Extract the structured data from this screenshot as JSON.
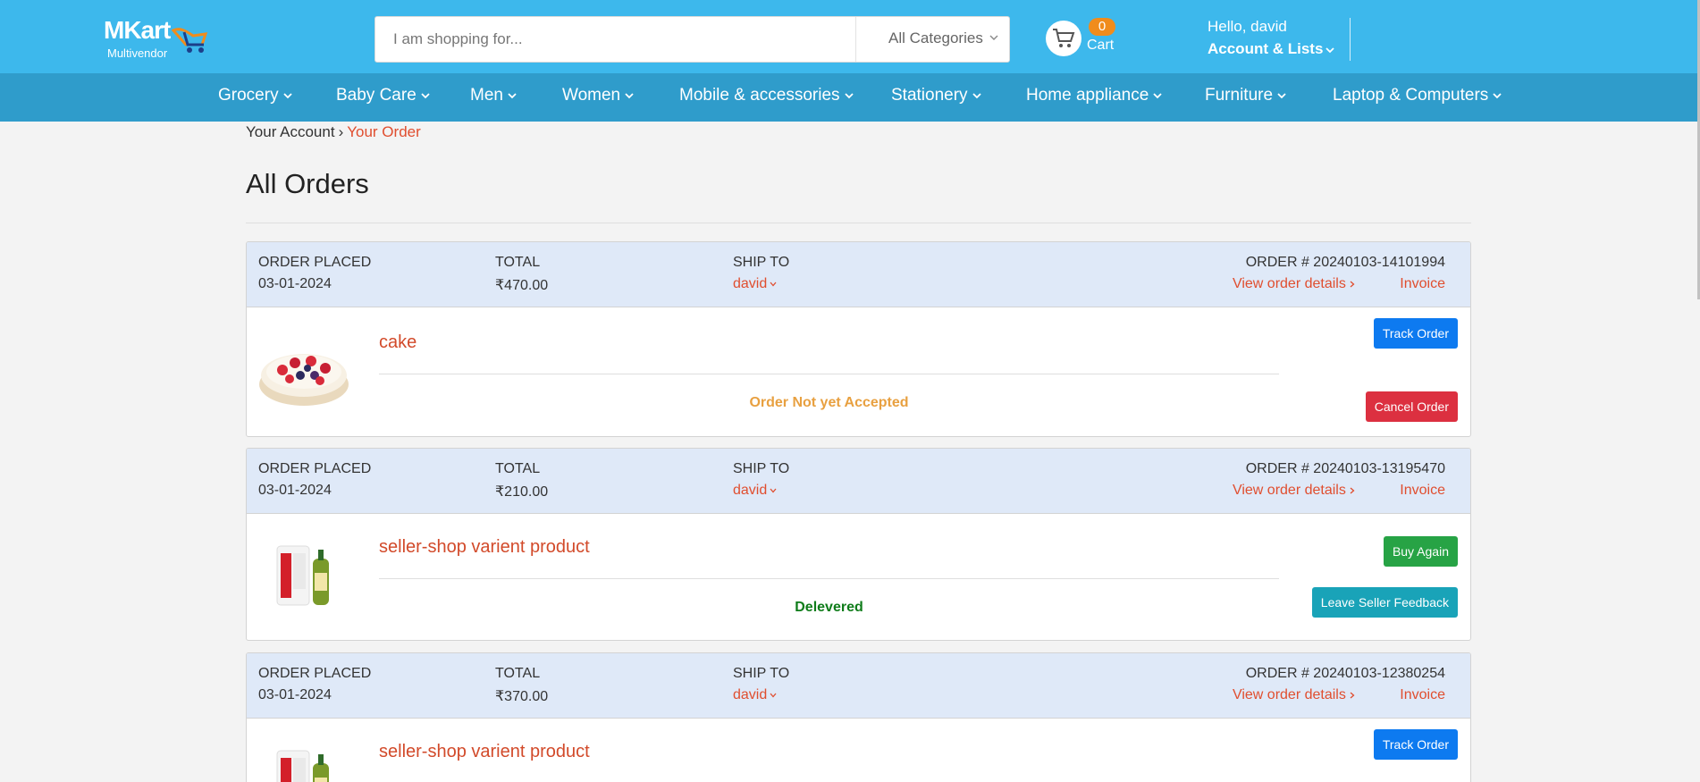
{
  "brand": {
    "name": "MKart",
    "tagline": "Multivendor"
  },
  "search": {
    "placeholder": "I am shopping for...",
    "category": "All Categories"
  },
  "cart": {
    "count": "0",
    "label": "Cart"
  },
  "account": {
    "greeting": "Hello, david",
    "menu_label": "Account & Lists"
  },
  "nav": [
    {
      "label": "Grocery"
    },
    {
      "label": "Baby Care"
    },
    {
      "label": "Men"
    },
    {
      "label": "Women"
    },
    {
      "label": "Mobile & accessories"
    },
    {
      "label": "Stationery"
    },
    {
      "label": "Home appliance"
    },
    {
      "label": "Furniture"
    },
    {
      "label": "Laptop & Computers"
    }
  ],
  "breadcrumb": {
    "parent": "Your Account",
    "separator": "›",
    "current": "Your Order"
  },
  "page_title": "All Orders",
  "labels": {
    "order_placed": "ORDER PLACED",
    "total": "TOTAL",
    "ship_to": "SHIP TO",
    "view_details": "View order details",
    "invoice": "Invoice"
  },
  "orders": [
    {
      "date": "03-01-2024",
      "total": "₹470.00",
      "ship_to": "david",
      "order_no": "ORDER # 20240103-14101994",
      "product": "cake",
      "status": "Order Not yet Accepted",
      "actions": [
        "Track Order",
        "Cancel Order"
      ]
    },
    {
      "date": "03-01-2024",
      "total": "₹210.00",
      "ship_to": "david",
      "order_no": "ORDER # 20240103-13195470",
      "product": "seller-shop varient product",
      "status": "Delevered",
      "actions": [
        "Buy Again",
        "Leave Seller Feedback"
      ]
    },
    {
      "date": "03-01-2024",
      "total": "₹370.00",
      "ship_to": "david",
      "order_no": "ORDER # 20240103-12380254",
      "product": "seller-shop varient product",
      "status": "",
      "actions": [
        "Track Order"
      ]
    }
  ],
  "colors": {
    "header": "#3db8ec",
    "nav": "#2f9ccb",
    "accent": "#e04e2f",
    "pending": "#e8a040",
    "delivered": "#0f7c1a"
  }
}
